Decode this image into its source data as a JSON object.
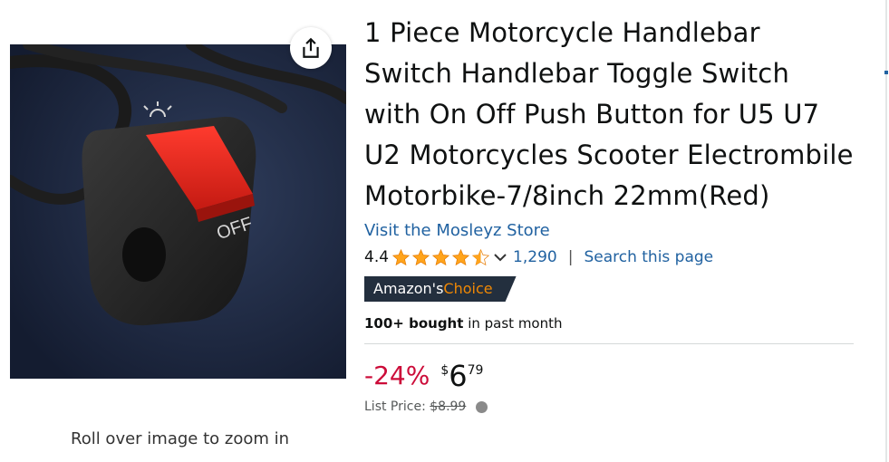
{
  "product": {
    "image_alt": "Motorcycle handlebar switch with red push button",
    "switch_label": "OFF",
    "zoom_hint": "Roll over image to zoom in",
    "title": "1 Piece Motorcycle Handlebar Switch Handlebar Toggle Switch with On Off Push Button for U5 U7 U2 Motorcycles Scooter Electrombile Motorbike-7/8inch 22mm(Red)",
    "store_link": "Visit the Mosleyz Store",
    "rating": {
      "value": "4.4",
      "stars": 4.5,
      "count": "1,290",
      "separator": "|",
      "search_link": "Search this page"
    },
    "badge": {
      "prefix": "Amazon's",
      "highlight": "Choice"
    },
    "bought": {
      "bold": "100+ bought",
      "rest": "in past month"
    },
    "price": {
      "discount": "-24%",
      "symbol": "$",
      "whole": "6",
      "fraction": "79",
      "list_label": "List Price:",
      "list_value": "$8.99"
    }
  },
  "colors": {
    "link": "#2162a1",
    "discount": "#cc0c39",
    "star": "#ffa41c",
    "badge_bg": "#232f3e",
    "badge_highlight": "#f08804"
  },
  "icons": {
    "share": "share-icon",
    "star": "star-icon",
    "chevron": "chevron-down-icon",
    "info": "info-icon"
  }
}
